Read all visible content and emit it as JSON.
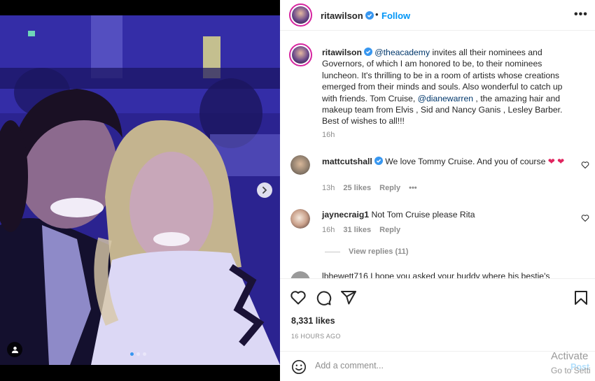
{
  "post": {
    "author": "ritawilson",
    "follow_label": "Follow",
    "separator": "•",
    "more_label": "•••"
  },
  "caption": {
    "username": "ritawilson",
    "mention1": "@theacademy",
    "text1": " invites all their nominees and Governors, of which I am honored to be, to their nominees luncheon. It's thrilling to be in a room of artists whose creations emerged from their minds and souls. Also wonderful to catch up with friends. Tom Cruise, ",
    "mention2": "@dianewarren",
    "text2": " , the amazing hair and makeup team from Elvis , Sid and Nancy Ganis , Lesley Barber. Best of wishes to all!!!",
    "time": "16h"
  },
  "comments": [
    {
      "username": "mattcutshall",
      "text": "We love Tommy Cruise. And you of course ",
      "emoji": "❤ ❤",
      "time": "13h",
      "likes": "25 likes",
      "reply_label": "Reply",
      "more": "•••"
    },
    {
      "username": "jaynecraig1",
      "text": "Not Tom Cruise please Rita",
      "time": "16h",
      "likes": "31 likes",
      "reply_label": "Reply"
    }
  ],
  "view_replies_label": "View replies (11)",
  "partial_comment": "lbhewett716 I hope you asked your buddy where his bestie's",
  "actions": {
    "likes": "8,331 likes",
    "posted": "16 HOURS AGO"
  },
  "composer": {
    "placeholder": "Add a comment...",
    "post_label": "Post"
  },
  "watermark": {
    "line1": "Activate",
    "line2": "Go to Setti"
  },
  "colors": {
    "accent": "#0095f6",
    "verified": "#3897f0",
    "heart": "#e0245e"
  },
  "icons": [
    "heart-icon",
    "comment-icon",
    "share-icon",
    "bookmark-icon",
    "emoji-icon",
    "chevron-right-icon",
    "user-tag-icon",
    "verified-icon",
    "more-icon"
  ]
}
